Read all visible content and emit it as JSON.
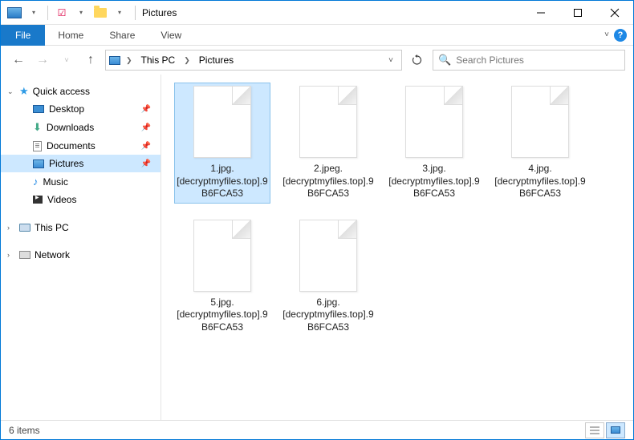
{
  "window": {
    "title": "Pictures"
  },
  "ribbon": {
    "file": "File",
    "tabs": [
      "Home",
      "Share",
      "View"
    ]
  },
  "address": {
    "crumbs": [
      "This PC",
      "Pictures"
    ]
  },
  "search": {
    "placeholder": "Search Pictures"
  },
  "sidebar": {
    "quick_access": {
      "label": "Quick access",
      "items": [
        {
          "label": "Desktop",
          "pinned": true
        },
        {
          "label": "Downloads",
          "pinned": true
        },
        {
          "label": "Documents",
          "pinned": true
        },
        {
          "label": "Pictures",
          "pinned": true,
          "active": true
        },
        {
          "label": "Music",
          "pinned": false
        },
        {
          "label": "Videos",
          "pinned": false
        }
      ]
    },
    "this_pc": {
      "label": "This PC"
    },
    "network": {
      "label": "Network"
    }
  },
  "files": [
    {
      "name": "1.jpg.[decryptmyfiles.top].9B6FCA53",
      "selected": true
    },
    {
      "name": "2.jpeg.[decryptmyfiles.top].9B6FCA53",
      "selected": false
    },
    {
      "name": "3.jpg.[decryptmyfiles.top].9B6FCA53",
      "selected": false
    },
    {
      "name": "4.jpg.[decryptmyfiles.top].9B6FCA53",
      "selected": false
    },
    {
      "name": "5.jpg.[decryptmyfiles.top].9B6FCA53",
      "selected": false
    },
    {
      "name": "6.jpg.[decryptmyfiles.top].9B6FCA53",
      "selected": false
    }
  ],
  "status": {
    "count_text": "6 items"
  }
}
